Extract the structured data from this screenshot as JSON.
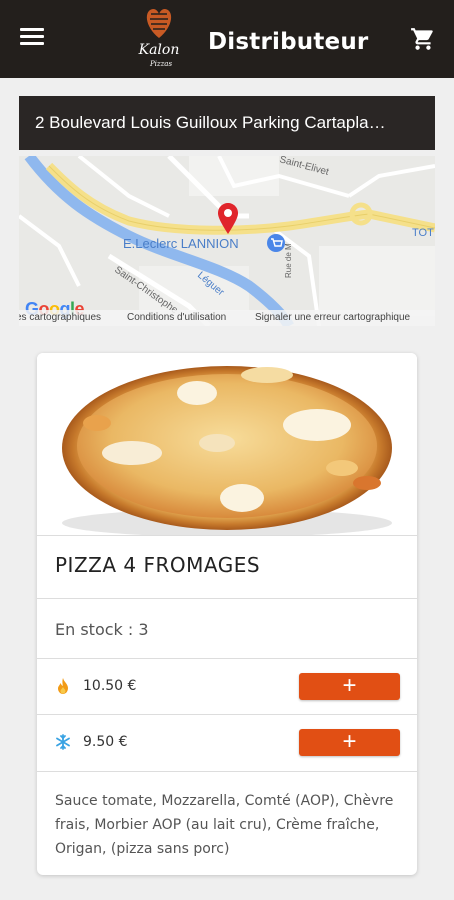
{
  "header": {
    "title": "Distributeur",
    "logo_text": "Kalon",
    "logo_subtext": "Pizzas",
    "menu_icon": "hamburger-menu-icon",
    "cart_icon": "shopping-cart-icon"
  },
  "address": {
    "text": "2 Boulevard Louis Guilloux Parking Cartapla…"
  },
  "map": {
    "place_label": "E.Leclerc LANNION",
    "street_labels": [
      "Saint-Elivet",
      "Saint-Christophe",
      "Léguer",
      "Rue de M",
      "TOT"
    ],
    "google_logo": "Google",
    "footer_links": [
      "es cartographiques",
      "Conditions d'utilisation",
      "Signaler une erreur cartographique"
    ]
  },
  "product": {
    "name": "PIZZA 4 FROMAGES",
    "stock": "En stock : 3",
    "prices": [
      {
        "icon": "flame-icon",
        "label": "10.50  €",
        "add_label": "+"
      },
      {
        "icon": "snowflake-icon",
        "label": "9.50  €",
        "add_label": "+"
      }
    ],
    "description": "Sauce tomate, Mozzarella, Comté (AOP), Chèvre frais, Morbier AOP (au lait cru), Crème fraîche, Origan, (pizza sans porc)"
  },
  "colors": {
    "topbar": "#231f1c",
    "accent": "#e14f14",
    "map_pin": "#e0252b",
    "river": "#8fb8ee",
    "road": "#f5e08a"
  }
}
